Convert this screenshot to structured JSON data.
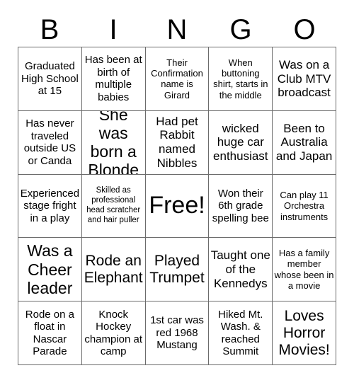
{
  "header": {
    "letters": [
      "B",
      "I",
      "N",
      "G",
      "O"
    ]
  },
  "grid": {
    "rows": [
      [
        {
          "text": "Graduated High School at 15",
          "size": "fs-md"
        },
        {
          "text": "Has been at birth of multiple babies",
          "size": "fs-md"
        },
        {
          "text": "Their Confirmation name is Girard",
          "size": "fs-sm"
        },
        {
          "text": "When buttoning shirt, starts in the middle",
          "size": "fs-sm"
        },
        {
          "text": "Was on a Club MTV broadcast",
          "size": "fs-lg"
        }
      ],
      [
        {
          "text": "Has never traveled outside US or Canda",
          "size": "fs-md"
        },
        {
          "text": "She was born a Blonde",
          "size": "fs-xxl"
        },
        {
          "text": "Had pet Rabbit named Nibbles",
          "size": "fs-lg"
        },
        {
          "text": "wicked huge car enthusiast",
          "size": "fs-lg"
        },
        {
          "text": "Been to Australia and Japan",
          "size": "fs-lg"
        }
      ],
      [
        {
          "text": "Experienced stage fright in a play",
          "size": "fs-md"
        },
        {
          "text": "Skilled as professional head scratcher and hair puller",
          "size": "fs-xs"
        },
        {
          "text": "Free!",
          "size": "fs-free"
        },
        {
          "text": "Won their 6th grade spelling bee",
          "size": "fs-md"
        },
        {
          "text": "Can play 11 Orchestra instruments",
          "size": "fs-sm"
        }
      ],
      [
        {
          "text": "Was a Cheer leader",
          "size": "fs-xxl"
        },
        {
          "text": "Rode an Elephant",
          "size": "fs-xl"
        },
        {
          "text": "Played Trumpet",
          "size": "fs-xl"
        },
        {
          "text": "Taught one of the Kennedys",
          "size": "fs-lg"
        },
        {
          "text": "Has a family member whose been in a movie",
          "size": "fs-sm"
        }
      ],
      [
        {
          "text": "Rode on a float in Nascar Parade",
          "size": "fs-md"
        },
        {
          "text": "Knock Hockey champion at camp",
          "size": "fs-md"
        },
        {
          "text": "1st car was red 1968 Mustang",
          "size": "fs-md"
        },
        {
          "text": "Hiked Mt. Wash. & reached Summit",
          "size": "fs-md"
        },
        {
          "text": "Loves Horror Movies!",
          "size": "fs-xl"
        }
      ]
    ]
  },
  "colors": {
    "background": "#ffffff",
    "text": "#000000",
    "border": "#6b6b6b"
  }
}
